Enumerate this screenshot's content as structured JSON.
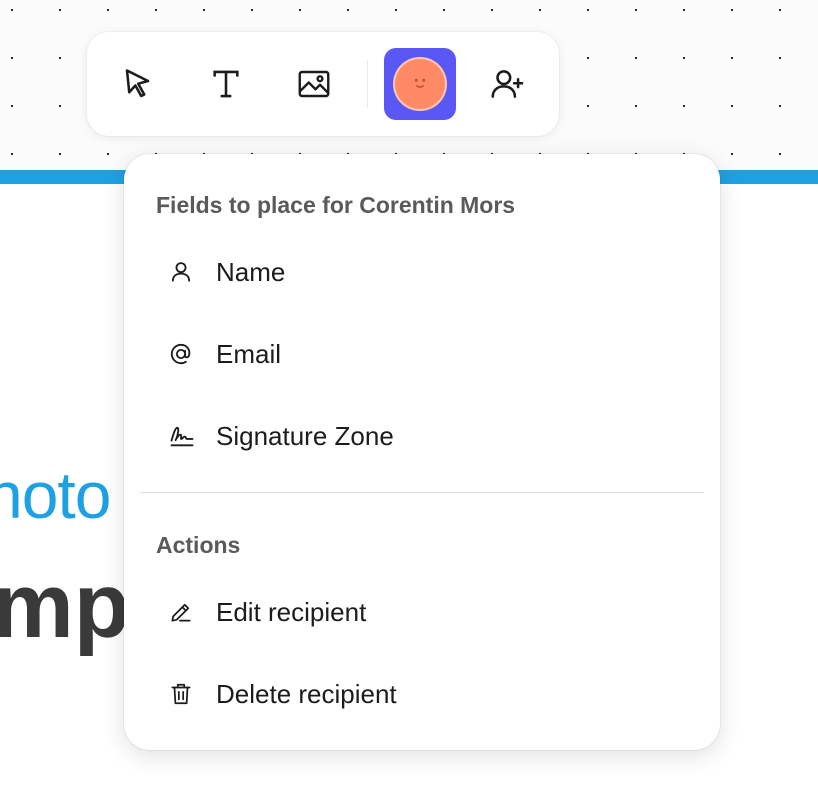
{
  "toolbar": {
    "tools": [
      {
        "name": "select",
        "icon": "cursor-arrow-icon"
      },
      {
        "name": "text",
        "icon": "text-t-icon"
      },
      {
        "name": "image",
        "icon": "image-icon"
      },
      {
        "name": "recipient",
        "icon": "smiley-avatar-icon",
        "active": true
      },
      {
        "name": "add-recipient",
        "icon": "user-plus-icon"
      }
    ]
  },
  "menu": {
    "fields_heading": "Fields to place for Corentin Mors",
    "fields": [
      {
        "label": "Name",
        "icon": "user-icon"
      },
      {
        "label": "Email",
        "icon": "at-sign-icon"
      },
      {
        "label": "Signature Zone",
        "icon": "signature-icon"
      }
    ],
    "actions_heading": "Actions",
    "actions": [
      {
        "label": "Edit recipient",
        "icon": "pencil-icon"
      },
      {
        "label": "Delete recipient",
        "icon": "trash-icon"
      }
    ]
  },
  "document": {
    "title_blue_fragment": "hoto",
    "title_dark_fragment": "mpl"
  },
  "colors": {
    "accent_blue": "#1ea1e3",
    "recipient_active": "#5b57f5",
    "avatar": "#ff8a66"
  }
}
